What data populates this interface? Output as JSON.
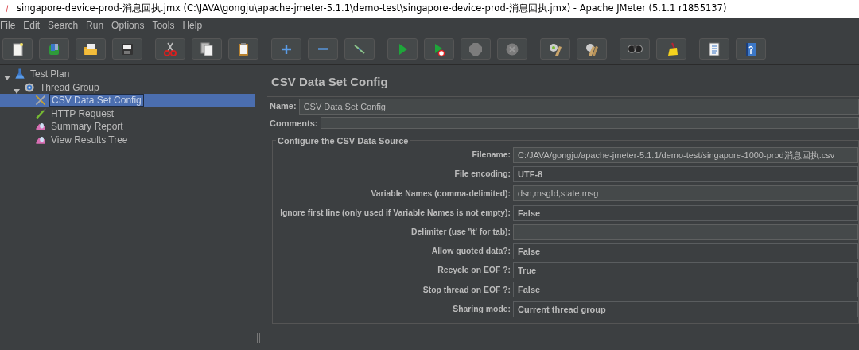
{
  "window": {
    "title": "singapore-device-prod-消息回执.jmx (C:\\JAVA\\gongju\\apache-jmeter-5.1.1\\demo-test\\singapore-device-prod-消息回执.jmx) - Apache JMeter (5.1.1 r1855137)"
  },
  "menu": [
    {
      "label": "File"
    },
    {
      "label": "Edit"
    },
    {
      "label": "Search"
    },
    {
      "label": "Run"
    },
    {
      "label": "Options"
    },
    {
      "label": "Tools"
    },
    {
      "label": "Help"
    }
  ],
  "toolbar": [
    [
      {
        "kind": "new",
        "disabled": false
      },
      {
        "kind": "templates",
        "disabled": false
      },
      {
        "kind": "open",
        "disabled": false
      },
      {
        "kind": "save",
        "disabled": false
      }
    ],
    [
      {
        "kind": "cut",
        "disabled": false
      },
      {
        "kind": "copy",
        "disabled": false
      },
      {
        "kind": "paste",
        "disabled": false
      }
    ],
    [
      {
        "kind": "add",
        "disabled": false
      },
      {
        "kind": "remove",
        "disabled": false
      },
      {
        "kind": "toggle",
        "disabled": false
      }
    ],
    [
      {
        "kind": "start",
        "disabled": false
      },
      {
        "kind": "start_no_pauses",
        "disabled": false
      },
      {
        "kind": "stop",
        "disabled": true
      },
      {
        "kind": "shutdown",
        "disabled": true
      }
    ],
    [
      {
        "kind": "clear",
        "disabled": false
      },
      {
        "kind": "clear_all",
        "disabled": false
      }
    ],
    [
      {
        "kind": "search",
        "disabled": false
      },
      {
        "kind": "reset_search",
        "disabled": false
      }
    ],
    [
      {
        "kind": "function_helper",
        "disabled": false
      },
      {
        "kind": "help",
        "disabled": false
      }
    ]
  ],
  "tree": [
    {
      "label": "Test Plan",
      "kind": "plan",
      "expanded": true,
      "selected": false,
      "children": [
        {
          "label": "Thread Group",
          "kind": "threads",
          "expanded": true,
          "selected": false,
          "children": [
            {
              "label": "CSV Data Set Config",
              "kind": "config",
              "selected": true
            },
            {
              "label": "HTTP Request",
              "kind": "sampler",
              "selected": false
            },
            {
              "label": "Summary Report",
              "kind": "listener",
              "selected": false
            },
            {
              "label": "View Results Tree",
              "kind": "listener",
              "selected": false
            }
          ]
        }
      ]
    }
  ],
  "panel": {
    "title": "CSV Data Set Config",
    "name_label": "Name:",
    "name_value": "CSV Data Set Config",
    "comments_label": "Comments:",
    "group_title": "Configure the CSV Data Source",
    "fields": [
      {
        "label": "Filename:",
        "value": "C:/JAVA/gongju/apache-jmeter-5.1.1/demo-test/singapore-1000-prod消息回执.csv",
        "kind": "text"
      },
      {
        "label": "File encoding:",
        "value": "UTF-8",
        "kind": "combo"
      },
      {
        "label": "Variable Names (comma-delimited):",
        "value": "dsn,msgId,state,msg",
        "kind": "text"
      },
      {
        "label": "Ignore first line (only used if Variable Names is not empty):",
        "value": "False",
        "kind": "combo"
      },
      {
        "label": "Delimiter (use '\\t' for tab):",
        "value": ",",
        "kind": "text"
      },
      {
        "label": "Allow quoted data?:",
        "value": "False",
        "kind": "combo"
      },
      {
        "label": "Recycle on EOF ?:",
        "value": "True",
        "kind": "combo"
      },
      {
        "label": "Stop thread on EOF ?:",
        "value": "False",
        "kind": "combo"
      },
      {
        "label": "Sharing mode:",
        "value": "Current thread group",
        "kind": "combo"
      }
    ]
  }
}
